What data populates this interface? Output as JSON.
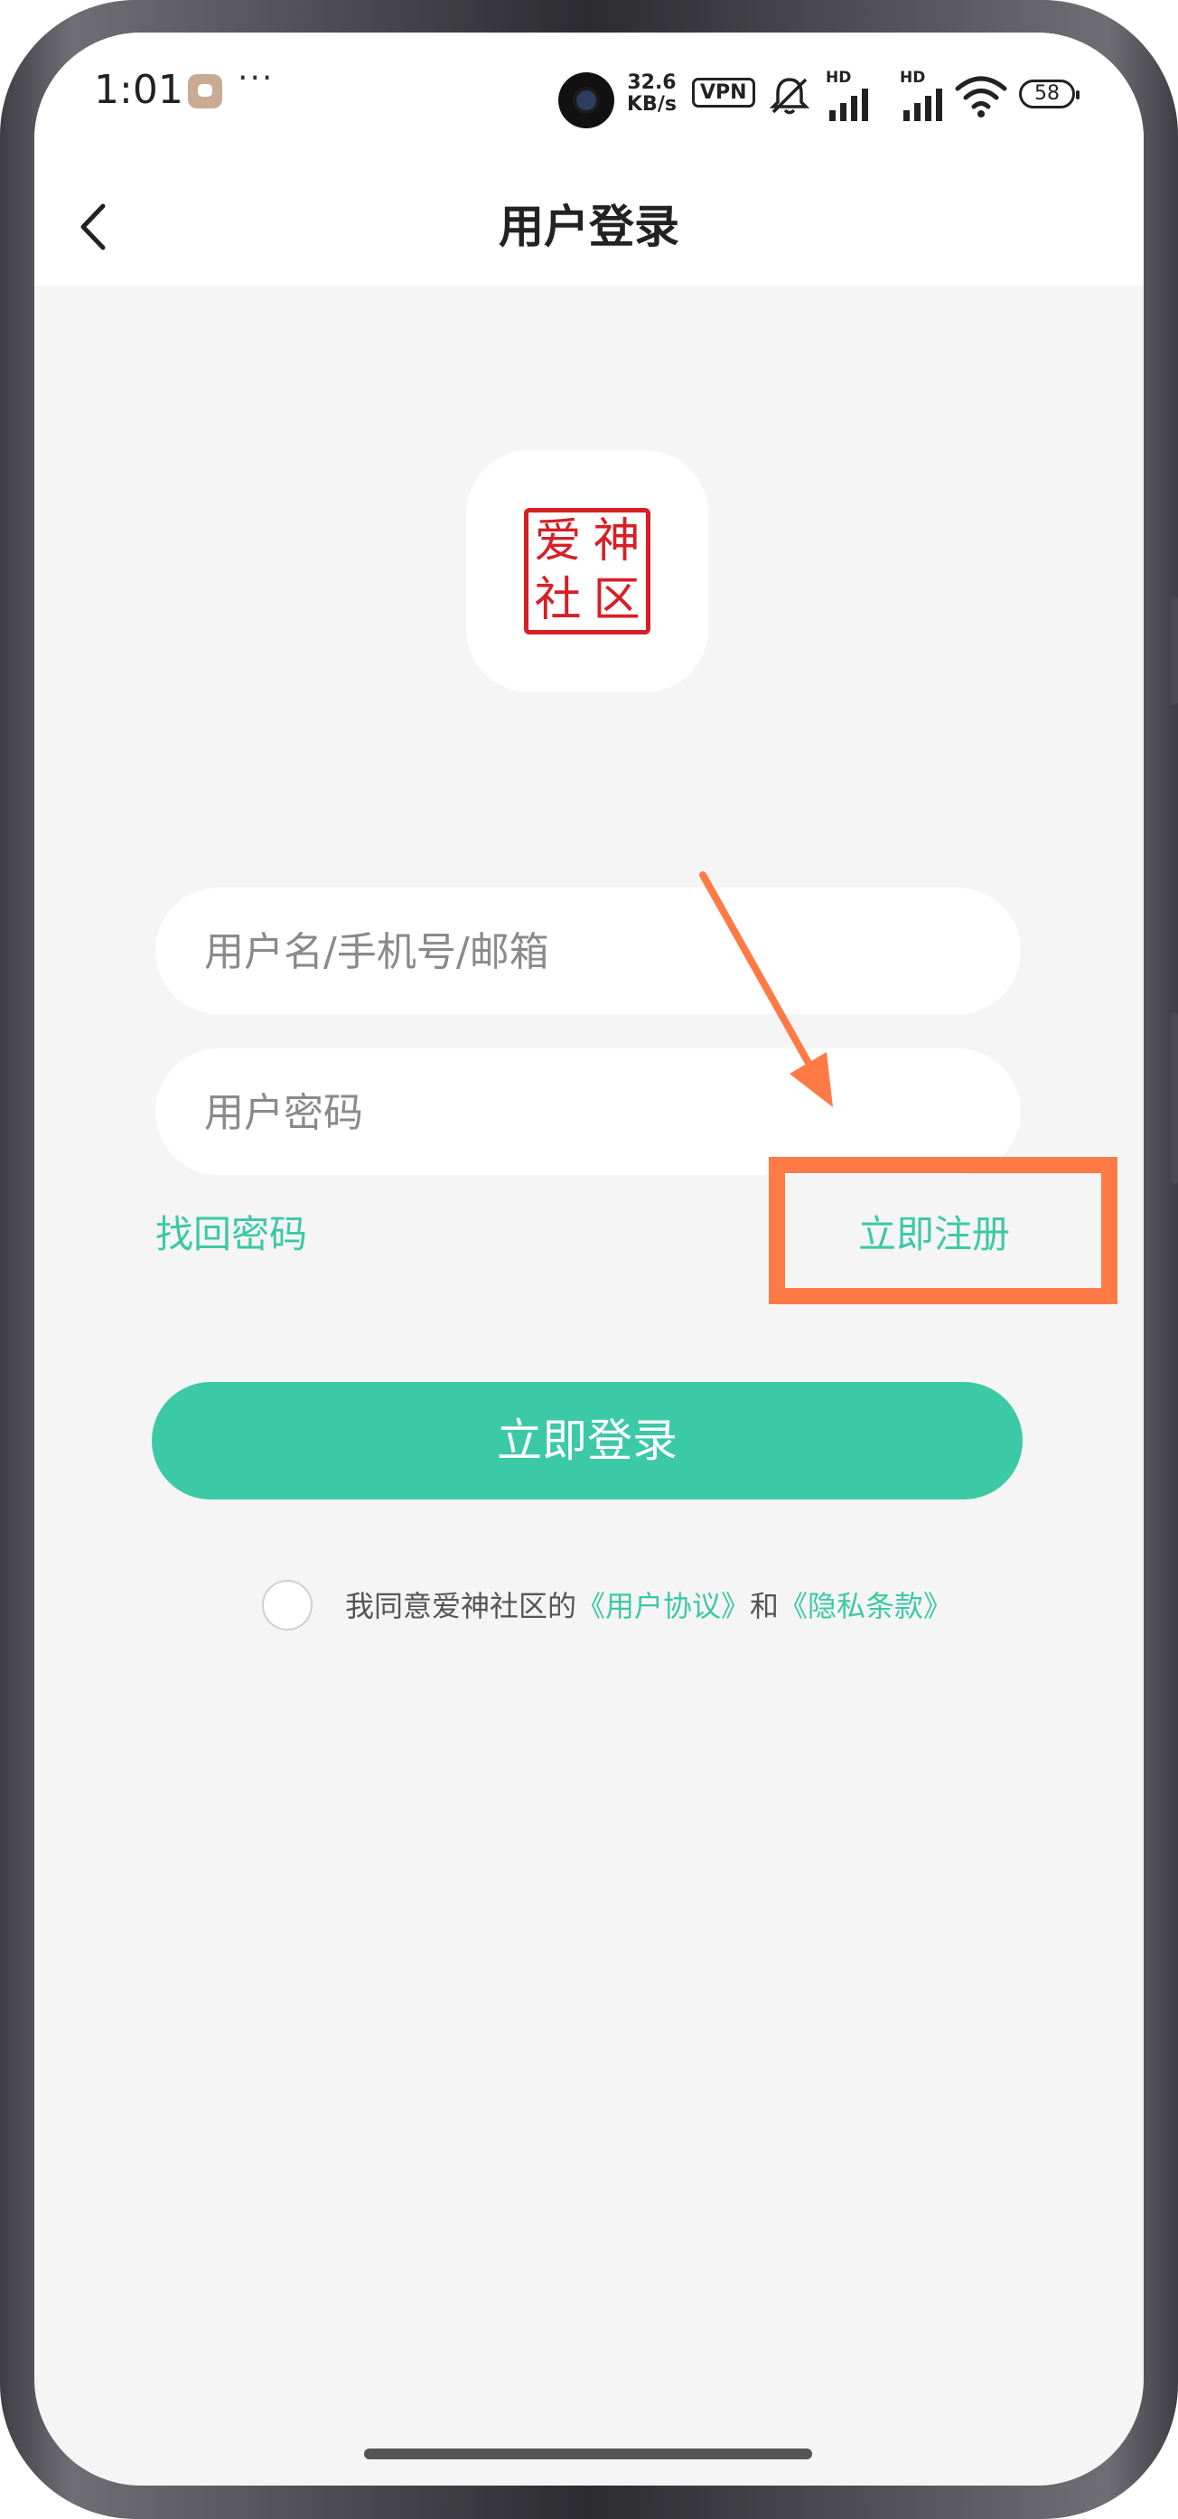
{
  "status_bar": {
    "time": "1:01",
    "more": "···",
    "net_speed_value": "32.6",
    "net_speed_unit": "KB/s",
    "vpn": "VPN",
    "signal_1_label": "HD",
    "signal_2_label": "HD",
    "battery": "58"
  },
  "nav": {
    "title": "用户登录"
  },
  "logo": {
    "seal_chars": [
      "爱",
      "神",
      "社",
      "区"
    ]
  },
  "form": {
    "username_placeholder": "用户名/手机号/邮箱",
    "username_value": "",
    "password_placeholder": "用户密码",
    "password_value": "",
    "forgot_password": "找回密码",
    "register": "立即注册",
    "login_button": "立即登录"
  },
  "agreement": {
    "checked": false,
    "prefix": "我同意爱神社区的",
    "user_agreement": "《用户协议》",
    "conjunction": "和",
    "privacy_policy": "《隐私条款》"
  },
  "colors": {
    "accent": "#3cc9a5",
    "annotation": "#ff7a45",
    "seal": "#d61f26",
    "background": "#f5f5f5"
  },
  "icons": {
    "back": "back-chevron-icon",
    "mute": "bell-off-icon",
    "wifi": "wifi-icon"
  }
}
